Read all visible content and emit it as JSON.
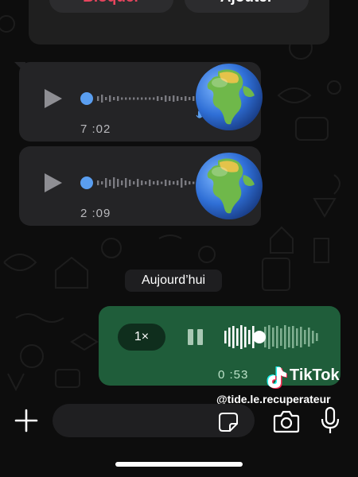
{
  "header_card": {
    "block_label": "Bloquer",
    "add_label": "Ajouter"
  },
  "messages": [
    {
      "type": "incoming-voice",
      "duration": "7 :02",
      "emoji": "earth-africa-globe-emoji"
    },
    {
      "type": "incoming-voice",
      "duration": "2 :09",
      "emoji": "earth-africa-globe-emoji"
    }
  ],
  "date_separator": "Aujourd’hui",
  "outgoing_voice": {
    "speed": "1×",
    "elapsed": "0 :53",
    "state": "playing",
    "progress": 0.36
  },
  "watermark": {
    "brand": "TikTok",
    "handle": "@tide.le.recuperateur"
  },
  "colors": {
    "block_red": "#e8455e",
    "incoming_bubble": "#242426",
    "outgoing_bubble": "#1f5d3a",
    "waveform_dot": "#5a9ef0"
  }
}
